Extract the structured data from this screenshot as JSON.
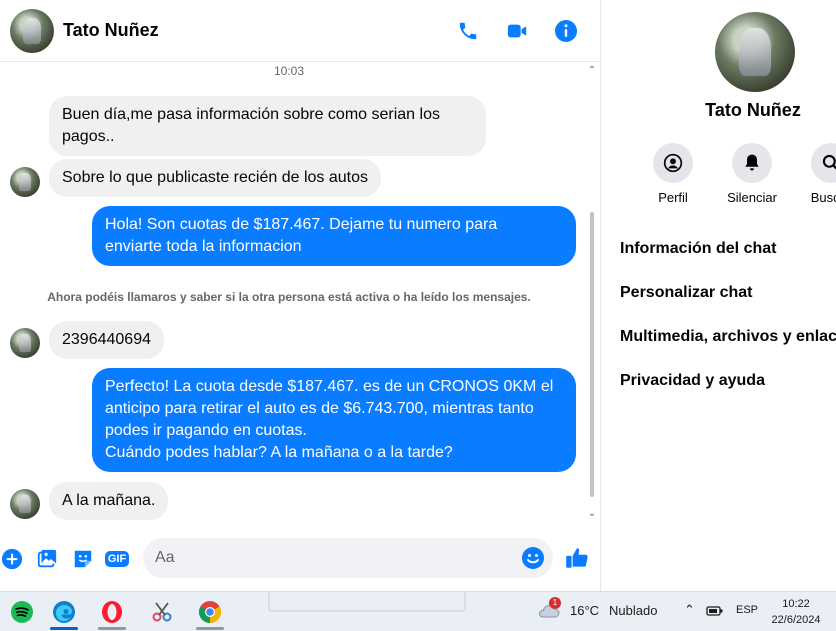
{
  "header": {
    "contact_name": "Tato Nuñez"
  },
  "thread": {
    "time_separator": "10:03",
    "notice": "Ahora podéis llamaros y saber si la otra persona está activa o ha leído los mensajes.",
    "messages": [
      {
        "direction": "incoming",
        "text": "Buen día,me pasa información sobre como serian los\npagos.."
      },
      {
        "direction": "incoming",
        "text": "Sobre lo que publicaste recién de los autos"
      },
      {
        "direction": "outgoing",
        "text": "Hola! Son cuotas de $187.467. Dejame tu numero para\nenviarte toda la informacion"
      },
      {
        "direction": "incoming",
        "text": "2396440694"
      },
      {
        "direction": "outgoing",
        "text": "Perfecto! La cuota desde $187.467. es de un CRONOS 0KM el\nanticipo para retirar el auto es de $6.743.700, mientras tanto\npodes ir pagando en cuotas.\nCuándo podes hablar? A la mañana o a la tarde?"
      },
      {
        "direction": "incoming",
        "text": "A la mañana."
      }
    ]
  },
  "composer": {
    "placeholder": "Aa",
    "gif_label": "GIF"
  },
  "details": {
    "name": "Tato Nuñez",
    "actions": [
      {
        "label": "Perfil",
        "icon": "profile-icon"
      },
      {
        "label": "Silenciar",
        "icon": "bell-icon"
      },
      {
        "label": "Buscar",
        "icon": "search-icon"
      }
    ],
    "menu": [
      "Información del chat",
      "Personalizar chat",
      "Multimedia, archivos y enlaces",
      "Privacidad y ayuda"
    ]
  },
  "taskbar": {
    "apps": [
      "spotify-icon",
      "edge-icon",
      "opera-icon",
      "snipping-tool-icon",
      "chrome-icon"
    ],
    "weather": {
      "badge": "1",
      "temp": "16°C",
      "condition": "Nublado"
    },
    "language": "ESP",
    "time": "10:22",
    "date": "22/6/2024"
  },
  "colors": {
    "accent": "#0a7cff",
    "incoming_bubble": "#f0f0f0",
    "taskbar": "#e9eff5"
  }
}
